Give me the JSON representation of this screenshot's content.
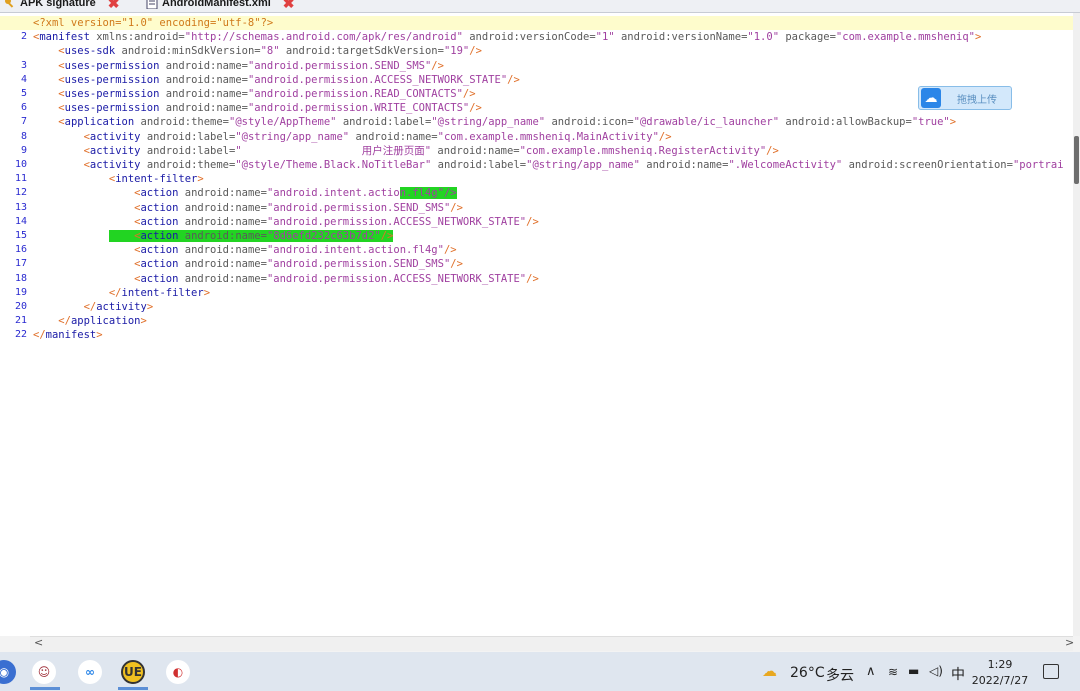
{
  "tabs": [
    {
      "label": "APK signature",
      "icon": "key-icon"
    },
    {
      "label": "AndroidManifest.xml",
      "icon": "document-icon"
    }
  ],
  "editor": {
    "lines": [
      {
        "n": "",
        "html": "<span class=\"prolog\">&lt;?xml version=\"1.0\" encoding=\"utf-8\"?&gt;</span>"
      },
      {
        "n": "2",
        "html": "<span class=\"p\">&lt;</span><span class=\"t\">manifest</span> <span class=\"a\">xmlns:android=</span><span class=\"v\">\"http://schemas.android.com/apk/res/android\"</span> <span class=\"a\">android:versionCode=</span><span class=\"v\">\"1\"</span> <span class=\"a\">android:versionName=</span><span class=\"v\">\"1.0\"</span> <span class=\"a\">package=</span><span class=\"v\">\"com.example.mmsheniq\"</span><span class=\"p\">&gt;</span>"
      },
      {
        "n": "",
        "html": "    <span class=\"p\">&lt;</span><span class=\"t\">uses-sdk</span> <span class=\"a\">android:minSdkVersion=</span><span class=\"v\">\"8\"</span> <span class=\"a\">android:targetSdkVersion=</span><span class=\"v\">\"19\"</span><span class=\"p\">/&gt;</span>"
      },
      {
        "n": "3",
        "html": "    <span class=\"p\">&lt;</span><span class=\"t\">uses-permission</span> <span class=\"a\">android:name=</span><span class=\"v\">\"android.permission.SEND_SMS\"</span><span class=\"p\">/&gt;</span>"
      },
      {
        "n": "4",
        "html": "    <span class=\"p\">&lt;</span><span class=\"t\">uses-permission</span> <span class=\"a\">android:name=</span><span class=\"v\">\"android.permission.ACCESS_NETWORK_STATE\"</span><span class=\"p\">/&gt;</span>"
      },
      {
        "n": "5",
        "html": "    <span class=\"p\">&lt;</span><span class=\"t\">uses-permission</span> <span class=\"a\">android:name=</span><span class=\"v\">\"android.permission.READ_CONTACTS\"</span><span class=\"p\">/&gt;</span>"
      },
      {
        "n": "6",
        "html": "    <span class=\"p\">&lt;</span><span class=\"t\">uses-permission</span> <span class=\"a\">android:name=</span><span class=\"v\">\"android.permission.WRITE_CONTACTS\"</span><span class=\"p\">/&gt;</span>"
      },
      {
        "n": "7",
        "html": "    <span class=\"p\">&lt;</span><span class=\"t\">application</span> <span class=\"a\">android:theme=</span><span class=\"v\">\"@style/AppTheme\"</span> <span class=\"a\">android:label=</span><span class=\"v\">\"@string/app_name\"</span> <span class=\"a\">android:icon=</span><span class=\"v\">\"@drawable/ic_launcher\"</span> <span class=\"a\">android:allowBackup=</span><span class=\"v\">\"true\"</span><span class=\"p\">&gt;</span>"
      },
      {
        "n": "8",
        "html": "        <span class=\"p\">&lt;</span><span class=\"t\">activity</span> <span class=\"a\">android:label=</span><span class=\"v\">\"@string/app_name\"</span> <span class=\"a\">android:name=</span><span class=\"v\">\"com.example.mmsheniq.MainActivity\"</span><span class=\"p\">/&gt;</span>"
      },
      {
        "n": "9",
        "html": "        <span class=\"p\">&lt;</span><span class=\"t\">activity</span> <span class=\"a\">android:label=</span><span class=\"v\">\"                   用户注册页面\"</span> <span class=\"a\">android:name=</span><span class=\"v\">\"com.example.mmsheniq.RegisterActivity\"</span><span class=\"p\">/&gt;</span>"
      },
      {
        "n": "10",
        "html": "        <span class=\"p\">&lt;</span><span class=\"t\">activity</span> <span class=\"a\">android:theme=</span><span class=\"v\">\"@style/Theme.Black.NoTitleBar\"</span> <span class=\"a\">android:label=</span><span class=\"v\">\"@string/app_name\"</span> <span class=\"a\">android:name=</span><span class=\"v\">\".WelcomeActivity\"</span> <span class=\"a\">android:screenOrientation=</span><span class=\"v\">\"portrai</span>"
      },
      {
        "n": "11",
        "html": "            <span class=\"p\">&lt;</span><span class=\"t\">intent-filter</span><span class=\"p\">&gt;</span>"
      },
      {
        "n": "12",
        "html": "                <span class=\"p\">&lt;</span><span class=\"t\">action</span> <span class=\"a\">android:name=</span><span class=\"v\">\"android.intent.actio</span><span class=\"v greenmark\">n.fl4g\"/&gt;</span>"
      },
      {
        "n": "13",
        "html": "                <span class=\"p\">&lt;</span><span class=\"t\">action</span> <span class=\"a\">android:name=</span><span class=\"v\">\"android.permission.SEND_SMS\"</span><span class=\"p\">/&gt;</span>"
      },
      {
        "n": "14",
        "html": "                <span class=\"p\">&lt;</span><span class=\"t\">action</span> <span class=\"a\">android:name=</span><span class=\"v\">\"android.permission.ACCESS_NETWORK_STATE\"</span><span class=\"p\">/&gt;</span>"
      },
      {
        "n": "15",
        "html": "            <span class=\"greenmark\">    <span class=\"p\">&lt;</span><span class=\"t\">action</span> <span class=\"a\">android:name=</span><span class=\"v\">\"8d6efd232c63b7d2\"</span><span class=\"p\">/&gt;</span></span>"
      },
      {
        "n": "16",
        "html": "                <span class=\"p\">&lt;</span><span class=\"t\">action</span> <span class=\"a\">android:name=</span><span class=\"v\">\"android.intent.action.fl4g\"</span><span class=\"p\">/&gt;</span>"
      },
      {
        "n": "17",
        "html": "                <span class=\"p\">&lt;</span><span class=\"t\">action</span> <span class=\"a\">android:name=</span><span class=\"v\">\"android.permission.SEND_SMS\"</span><span class=\"p\">/&gt;</span>"
      },
      {
        "n": "18",
        "html": "                <span class=\"p\">&lt;</span><span class=\"t\">action</span> <span class=\"a\">android:name=</span><span class=\"v\">\"android.permission.ACCESS_NETWORK_STATE\"</span><span class=\"p\">/&gt;</span>"
      },
      {
        "n": "19",
        "html": "            <span class=\"p\">&lt;/</span><span class=\"t\">intent-filter</span><span class=\"p\">&gt;</span>"
      },
      {
        "n": "20",
        "html": "        <span class=\"p\">&lt;/</span><span class=\"t\">activity</span><span class=\"p\">&gt;</span>"
      },
      {
        "n": "21",
        "html": "    <span class=\"p\">&lt;/</span><span class=\"t\">application</span><span class=\"p\">&gt;</span>"
      },
      {
        "n": "22",
        "html": "<span class=\"p\">&lt;/</span><span class=\"t\">manifest</span><span class=\"p\">&gt;</span>"
      }
    ]
  },
  "upload_widget": {
    "label": "拖拽上传",
    "icon": "cloud-icon"
  },
  "taskbar": {
    "apps": [
      "globe-icon",
      "avatar-icon",
      "baidu-netdisk-icon",
      "ue-editor-icon",
      "browser-icon"
    ],
    "weather": {
      "temp": "26°C",
      "desc": "多云"
    },
    "ime": "中",
    "time": "1:29",
    "date": "2022/7/27"
  },
  "colors": {
    "highlight": "#22d422",
    "line_highlight": "#fefccc",
    "accent": "#2b86e8"
  }
}
